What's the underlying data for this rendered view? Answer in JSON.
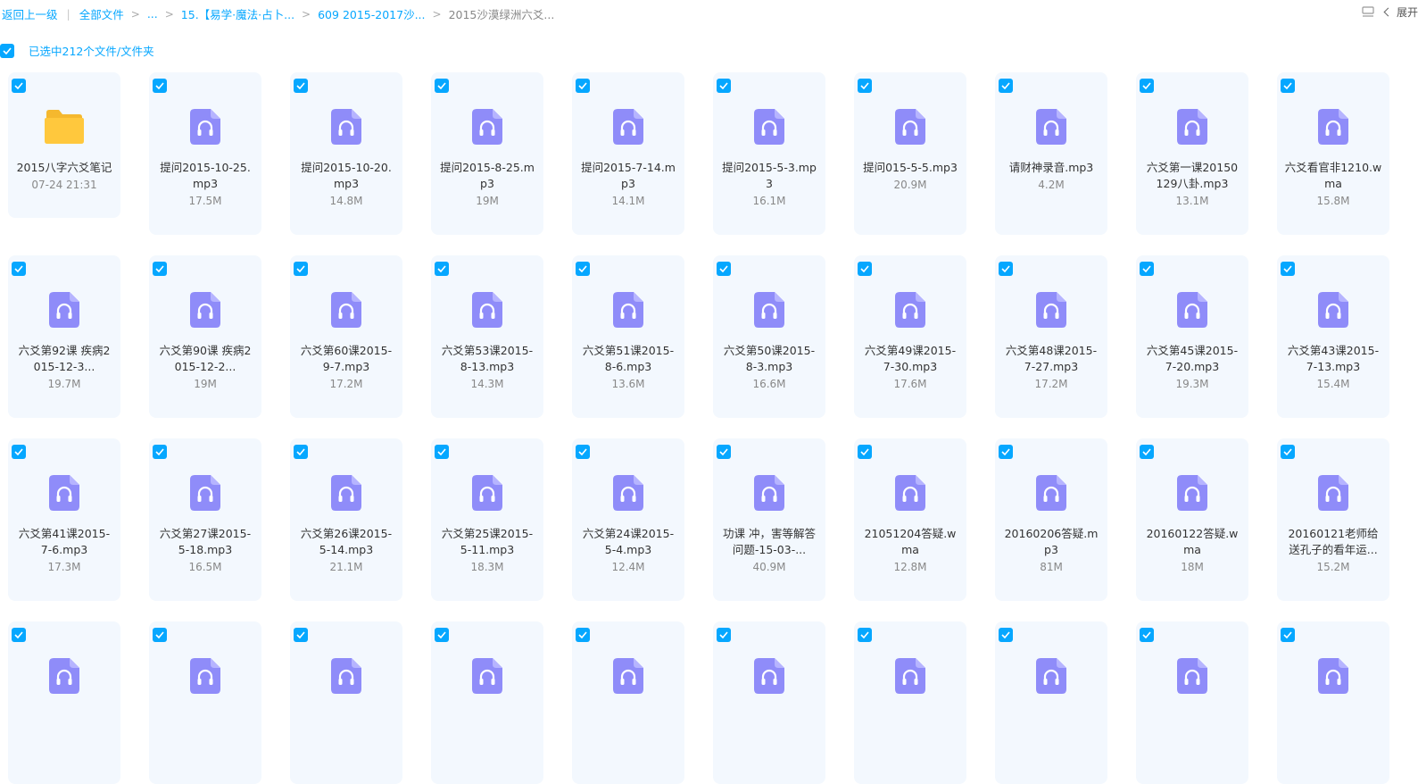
{
  "breadcrumb": {
    "back": "返回上一级",
    "items": [
      "全部文件",
      "...",
      "15.【易学·魔法·占卜...",
      "609 2015-2017沙...",
      "2015沙漠绿洲六爻..."
    ]
  },
  "toolbar": {
    "expand_label": "展开"
  },
  "selection": {
    "text": "已选中212个文件/文件夹"
  },
  "colors": {
    "accent": "#06a7ff",
    "card_bg": "#f3f8fe",
    "audio_icon": "#8f8cf9",
    "folder": "#ffc83d"
  },
  "files": [
    {
      "name": "2015八字六爻笔记",
      "meta": "07-24 21:31",
      "icon": "folder-icon"
    },
    {
      "name": "提问2015-10-25.mp3",
      "meta": "17.5M",
      "icon": "audio-file-icon"
    },
    {
      "name": "提问2015-10-20.mp3",
      "meta": "14.8M",
      "icon": "audio-file-icon"
    },
    {
      "name": "提问2015-8-25.mp3",
      "meta": "19M",
      "icon": "audio-file-icon"
    },
    {
      "name": "提问2015-7-14.mp3",
      "meta": "14.1M",
      "icon": "audio-file-icon"
    },
    {
      "name": "提问2015-5-3.mp3",
      "meta": "16.1M",
      "icon": "audio-file-icon"
    },
    {
      "name": "提问015-5-5.mp3",
      "meta": "20.9M",
      "icon": "audio-file-icon"
    },
    {
      "name": "请财神录音.mp3",
      "meta": "4.2M",
      "icon": "audio-file-icon"
    },
    {
      "name": "六爻第一课20150129八卦.mp3",
      "meta": "13.1M",
      "icon": "audio-file-icon"
    },
    {
      "name": "六爻看官非1210.wma",
      "meta": "15.8M",
      "icon": "audio-file-icon"
    },
    {
      "name": "六爻第92课 疾病2015-12-3...",
      "meta": "19.7M",
      "icon": "audio-file-icon"
    },
    {
      "name": "六爻第90课 疾病2015-12-2...",
      "meta": "19M",
      "icon": "audio-file-icon"
    },
    {
      "name": "六爻第60课2015-9-7.mp3",
      "meta": "17.2M",
      "icon": "audio-file-icon"
    },
    {
      "name": "六爻第53课2015-8-13.mp3",
      "meta": "14.3M",
      "icon": "audio-file-icon"
    },
    {
      "name": "六爻第51课2015-8-6.mp3",
      "meta": "13.6M",
      "icon": "audio-file-icon"
    },
    {
      "name": "六爻第50课2015-8-3.mp3",
      "meta": "16.6M",
      "icon": "audio-file-icon"
    },
    {
      "name": "六爻第49课2015-7-30.mp3",
      "meta": "17.6M",
      "icon": "audio-file-icon"
    },
    {
      "name": "六爻第48课2015-7-27.mp3",
      "meta": "17.2M",
      "icon": "audio-file-icon"
    },
    {
      "name": "六爻第45课2015-7-20.mp3",
      "meta": "19.3M",
      "icon": "audio-file-icon"
    },
    {
      "name": "六爻第43课2015-7-13.mp3",
      "meta": "15.4M",
      "icon": "audio-file-icon"
    },
    {
      "name": "六爻第41课2015-7-6.mp3",
      "meta": "17.3M",
      "icon": "audio-file-icon"
    },
    {
      "name": "六爻第27课2015-5-18.mp3",
      "meta": "16.5M",
      "icon": "audio-file-icon"
    },
    {
      "name": "六爻第26课2015-5-14.mp3",
      "meta": "21.1M",
      "icon": "audio-file-icon"
    },
    {
      "name": "六爻第25课2015-5-11.mp3",
      "meta": "18.3M",
      "icon": "audio-file-icon"
    },
    {
      "name": "六爻第24课2015-5-4.mp3",
      "meta": "12.4M",
      "icon": "audio-file-icon"
    },
    {
      "name": "功课 冲，害等解答问题-15-03-...",
      "meta": "40.9M",
      "icon": "audio-file-icon"
    },
    {
      "name": "21051204答疑.wma",
      "meta": "12.8M",
      "icon": "audio-file-icon"
    },
    {
      "name": "20160206答疑.mp3",
      "meta": "81M",
      "icon": "audio-file-icon"
    },
    {
      "name": "20160122答疑.wma",
      "meta": "18M",
      "icon": "audio-file-icon"
    },
    {
      "name": "20160121老师给送孔子的看年运...",
      "meta": "15.2M",
      "icon": "audio-file-icon"
    },
    {
      "name": "",
      "meta": "",
      "icon": "audio-file-icon"
    },
    {
      "name": "",
      "meta": "",
      "icon": "audio-file-icon"
    },
    {
      "name": "",
      "meta": "",
      "icon": "audio-file-icon"
    },
    {
      "name": "",
      "meta": "",
      "icon": "audio-file-icon"
    },
    {
      "name": "",
      "meta": "",
      "icon": "audio-file-icon"
    },
    {
      "name": "",
      "meta": "",
      "icon": "audio-file-icon"
    },
    {
      "name": "",
      "meta": "",
      "icon": "audio-file-icon"
    },
    {
      "name": "",
      "meta": "",
      "icon": "audio-file-icon"
    },
    {
      "name": "",
      "meta": "",
      "icon": "audio-file-icon"
    },
    {
      "name": "",
      "meta": "",
      "icon": "audio-file-icon"
    }
  ]
}
